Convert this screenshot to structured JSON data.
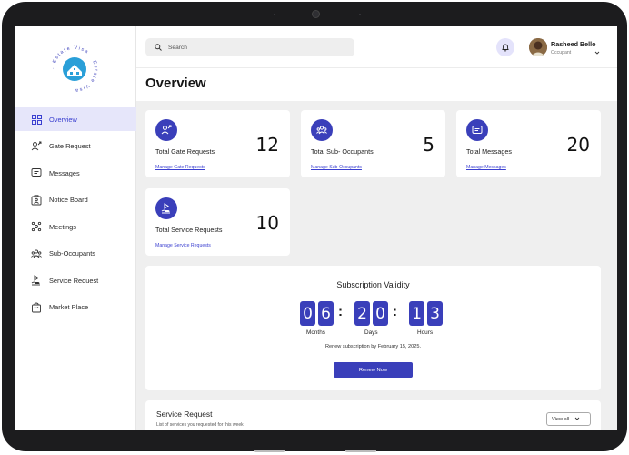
{
  "logo": {
    "ring_text": "· Estate Visa · Estate Visa",
    "alt": "Estate Visa"
  },
  "sidebar": {
    "items": [
      {
        "label": "Overview",
        "icon": "grid-icon",
        "active": true
      },
      {
        "label": "Gate Request",
        "icon": "user-arrow-icon",
        "active": false
      },
      {
        "label": "Messages",
        "icon": "message-icon",
        "active": false
      },
      {
        "label": "Notice Board",
        "icon": "notice-board-icon",
        "active": false
      },
      {
        "label": "Meetings",
        "icon": "meetings-icon",
        "active": false
      },
      {
        "label": "Sub-Occupants",
        "icon": "group-icon",
        "active": false
      },
      {
        "label": "Service Request",
        "icon": "service-icon",
        "active": false
      },
      {
        "label": "Market Place",
        "icon": "shopping-bag-icon",
        "active": false
      }
    ]
  },
  "header": {
    "search_placeholder": "Search",
    "user_name": "Rasheed Bello",
    "user_role": "Occupant"
  },
  "page": {
    "title": "Overview"
  },
  "stats": [
    {
      "title": "Total Gate Requests",
      "value": "12",
      "link": "Manage Gate Requests",
      "icon": "user-arrow-icon"
    },
    {
      "title": "Total Sub- Occupants",
      "value": "5",
      "link": "Manage Sub-Occupants",
      "icon": "group-icon"
    },
    {
      "title": "Total Messages",
      "value": "20",
      "link": "Manage Messages",
      "icon": "message-icon"
    },
    {
      "title": "Total Service Requests",
      "value": "10",
      "link": "Manage Service Requests",
      "icon": "service-icon"
    }
  ],
  "subscription": {
    "title": "Subscription Validity",
    "digits": [
      "0",
      "6",
      "2",
      "0",
      "1",
      "3"
    ],
    "units": [
      "Months",
      "Days",
      "Hours"
    ],
    "note": "Renew subscription by February 15, 2025.",
    "button": "Renew Now"
  },
  "service_request": {
    "title": "Service Request",
    "subtitle": "List of services you requested for this week",
    "view_all": "View all"
  },
  "colors": {
    "accent": "#3a3fba",
    "active_bg": "#e6e6fa",
    "bell_bg": "#e4e3fb"
  }
}
